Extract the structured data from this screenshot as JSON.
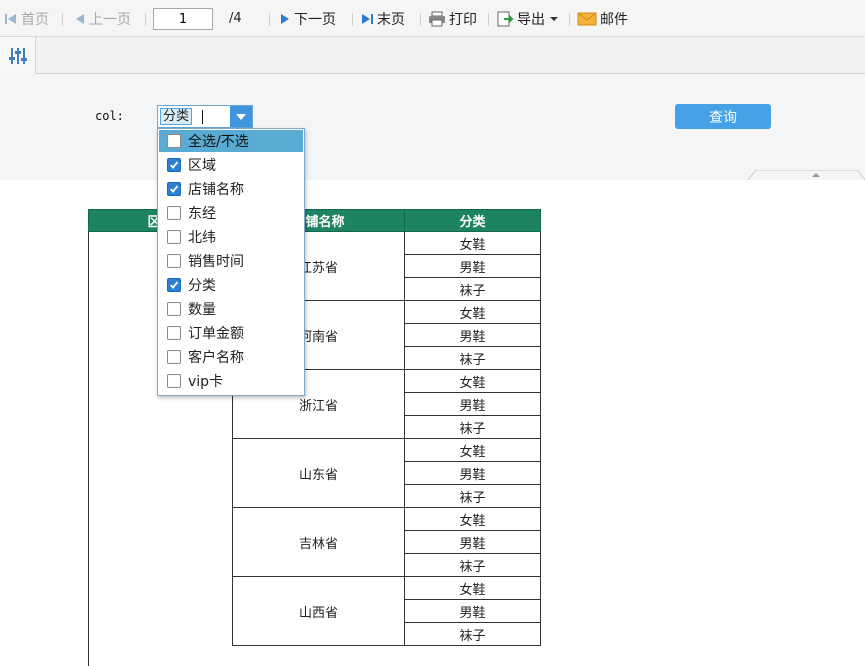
{
  "toolbar": {
    "first_page": "首页",
    "prev_page": "上一页",
    "page_input": "1",
    "page_total": "/4",
    "next_page": "下一页",
    "last_page": "末页",
    "print": "打印",
    "export": "导出",
    "email": "邮件"
  },
  "params": {
    "col_label": "col:",
    "combo_tag": "分类",
    "query_button": "查询"
  },
  "dropdown": {
    "items": [
      {
        "label": "全选/不选",
        "checked": false
      },
      {
        "label": "区域",
        "checked": true
      },
      {
        "label": "店铺名称",
        "checked": true
      },
      {
        "label": "东经",
        "checked": false
      },
      {
        "label": "北纬",
        "checked": false
      },
      {
        "label": "销售时间",
        "checked": false
      },
      {
        "label": "分类",
        "checked": true
      },
      {
        "label": "数量",
        "checked": false
      },
      {
        "label": "订单金额",
        "checked": false
      },
      {
        "label": "客户名称",
        "checked": false
      },
      {
        "label": "vip卡",
        "checked": false
      }
    ]
  },
  "table": {
    "headers": [
      "区域",
      "店铺名称",
      "分类"
    ],
    "groups": [
      {
        "store": "江苏省",
        "categories": [
          "女鞋",
          "男鞋",
          "袜子"
        ]
      },
      {
        "store": "河南省",
        "categories": [
          "女鞋",
          "男鞋",
          "袜子"
        ]
      },
      {
        "store": "浙江省",
        "categories": [
          "女鞋",
          "男鞋",
          "袜子"
        ]
      },
      {
        "store": "山东省",
        "categories": [
          "女鞋",
          "男鞋",
          "袜子"
        ]
      },
      {
        "store": "吉林省",
        "categories": [
          "女鞋",
          "男鞋",
          "袜子"
        ]
      },
      {
        "store": "山西省",
        "categories": [
          "女鞋",
          "男鞋",
          "袜子"
        ]
      }
    ]
  },
  "colors": {
    "header_green": "#1e8363",
    "accent_blue": "#47a1e6",
    "checkbox_blue": "#2b7fd4",
    "highlight_row": "#5aabd3"
  }
}
